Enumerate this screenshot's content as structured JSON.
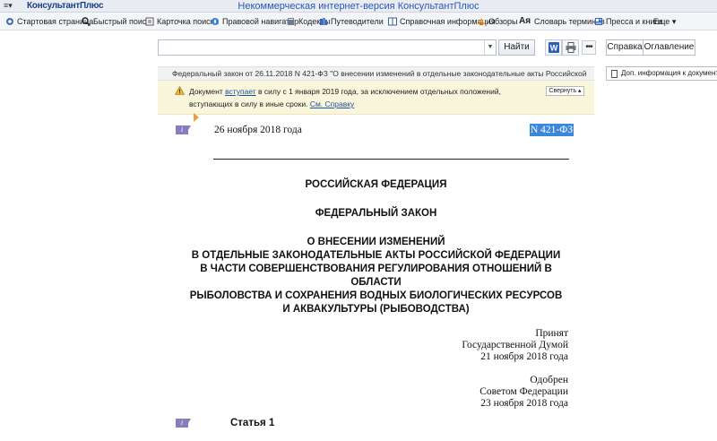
{
  "app": {
    "logo_text": "КонсультантПлюс",
    "window_title": "Некоммерческая интернет-версия КонсультантПлюс",
    "menu_icon": "menu-icon"
  },
  "toolbar": {
    "items": [
      {
        "label": "Стартовая страница",
        "icon": "home-icon"
      },
      {
        "label": "Быстрый поиск",
        "icon": "search-icon"
      },
      {
        "label": "Карточка поиска",
        "icon": "card-icon"
      },
      {
        "label": "Правовой навигатор",
        "icon": "navigator-icon"
      },
      {
        "label": "Кодексы",
        "icon": "codex-icon"
      },
      {
        "label": "Путеводители",
        "icon": "guides-icon"
      },
      {
        "label": "Справочная информация",
        "icon": "reference-icon"
      },
      {
        "label": "Обзоры",
        "icon": "reviews-icon"
      },
      {
        "label": "Словарь терминов",
        "icon": "dictionary-icon"
      },
      {
        "label": "Пресса и книги",
        "icon": "press-icon"
      },
      {
        "label": "Еще ▾",
        "icon": ""
      }
    ]
  },
  "search": {
    "value": "",
    "placeholder": "",
    "find_label": "Найти"
  },
  "right_panel": {
    "tab_reference": "Справка",
    "tab_contents": "Оглавление",
    "additional_info": "Доп. информация к документу"
  },
  "document": {
    "header": "Федеральный закон от 26.11.2018 N 421-ФЗ \"О внесении изменений в отдельные законодательные акты Российской",
    "notice": {
      "text_before": "Документ ",
      "link_enters": "вступает",
      "text_after": " в силу с 1 января 2019 года, за исключением отдельных положений, вступающих в силу в иные сроки. ",
      "link_help": "См. Справку",
      "collapse_label": "Свернуть ▴"
    },
    "badge": "i",
    "date": "26 ноября 2018 года",
    "number": "N 421-ФЗ",
    "country": "РОССИЙСКАЯ ФЕДЕРАЦИЯ",
    "type": "ФЕДЕРАЛЬНЫЙ ЗАКОН",
    "title_lines": [
      "О ВНЕСЕНИИ ИЗМЕНЕНИЙ",
      "В ОТДЕЛЬНЫЕ ЗАКОНОДАТЕЛЬНЫЕ АКТЫ РОССИЙСКОЙ ФЕДЕРАЦИИ",
      "В ЧАСТИ СОВЕРШЕНСТВОВАНИЯ РЕГУЛИРОВАНИЯ ОТНОШЕНИЙ В",
      "ОБЛАСТИ",
      "РЫБОЛОВСТВА И СОХРАНЕНИЯ ВОДНЫХ БИОЛОГИЧЕСКИХ РЕСУРСОВ",
      "И АКВАКУЛЬТУРЫ (РЫБОВОДСТВА)"
    ],
    "adopted": [
      "Принят",
      "Государственной Думой",
      "21 ноября 2018 года"
    ],
    "approved": [
      "Одобрен",
      "Советом Федерации",
      "23 ноября 2018 года"
    ],
    "article": "Статья 1"
  }
}
